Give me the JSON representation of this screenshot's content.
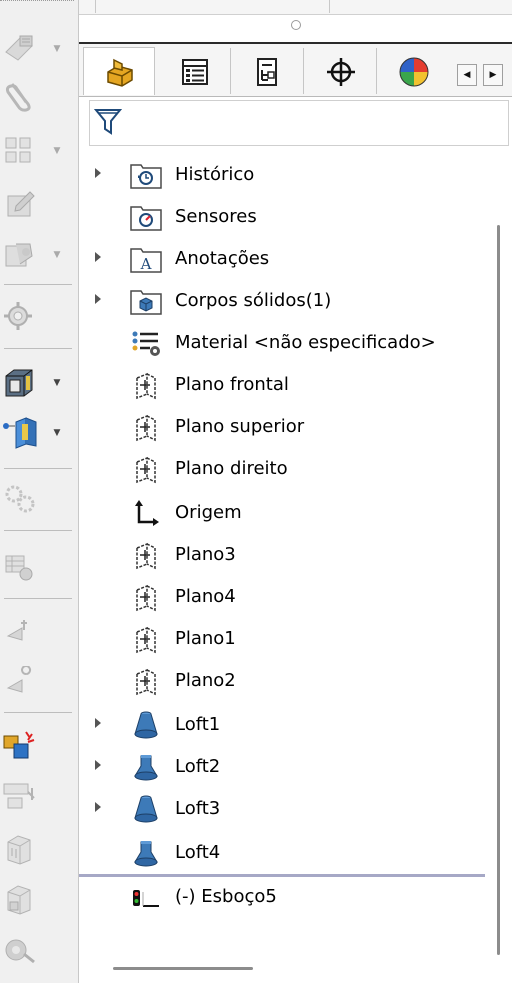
{
  "toolbar": {
    "buttons": [
      {
        "icon": "sketch-icon",
        "has_dropdown": true
      },
      {
        "icon": "paperclip-icon",
        "has_dropdown": false
      },
      {
        "icon": "grid-pattern-icon",
        "has_dropdown": true
      },
      {
        "icon": "document-edit-icon",
        "has_dropdown": false
      },
      {
        "icon": "feature-copy-icon",
        "has_dropdown": true
      },
      {
        "icon": "gear-feature-icon",
        "has_dropdown": false
      },
      {
        "icon": "extrude-boss-icon",
        "has_dropdown": true
      },
      {
        "icon": "reference-plane-icon",
        "has_dropdown": true
      },
      {
        "icon": "gears-icon",
        "has_dropdown": false
      },
      {
        "icon": "display-icon",
        "has_dropdown": false
      },
      {
        "icon": "dimension-icon",
        "has_dropdown": false
      },
      {
        "icon": "dimension-2-icon",
        "has_dropdown": false
      },
      {
        "icon": "instant3d-icon",
        "has_dropdown": false
      },
      {
        "icon": "layout-icon",
        "has_dropdown": false
      },
      {
        "icon": "part-icon",
        "has_dropdown": false
      },
      {
        "icon": "part-2-icon",
        "has_dropdown": false
      },
      {
        "icon": "camera-icon",
        "has_dropdown": false
      }
    ]
  },
  "tabs": [
    {
      "name": "featuremanager-tab",
      "icon": "featuremanager-icon",
      "active": true
    },
    {
      "name": "propertymanager-tab",
      "icon": "propertymanager-icon",
      "active": false
    },
    {
      "name": "configurationmanager-tab",
      "icon": "configurationmanager-icon",
      "active": false
    },
    {
      "name": "dimxpert-tab",
      "icon": "crosshair-icon",
      "active": false
    },
    {
      "name": "displaymanager-tab",
      "icon": "color-wheel-icon",
      "active": false
    }
  ],
  "tree": {
    "items": [
      {
        "label": "Histórico",
        "icon": "history-folder-icon",
        "expandable": true
      },
      {
        "label": "Sensores",
        "icon": "sensor-folder-icon",
        "expandable": false
      },
      {
        "label": "Anotações",
        "icon": "annotation-folder-icon",
        "expandable": true
      },
      {
        "label": "Corpos sólidos(1)",
        "icon": "solid-bodies-folder-icon",
        "expandable": true
      },
      {
        "label": "Material <não especificado>",
        "icon": "material-icon",
        "expandable": false
      },
      {
        "label": "Plano frontal",
        "icon": "plane-icon",
        "expandable": false
      },
      {
        "label": "Plano superior",
        "icon": "plane-icon",
        "expandable": false
      },
      {
        "label": "Plano direito",
        "icon": "plane-icon",
        "expandable": false
      },
      {
        "label": "Origem",
        "icon": "origin-icon",
        "expandable": false
      },
      {
        "label": "Plano3",
        "icon": "plane-icon",
        "expandable": false
      },
      {
        "label": "Plano4",
        "icon": "plane-icon",
        "expandable": false
      },
      {
        "label": "Plano1",
        "icon": "plane-icon",
        "expandable": false
      },
      {
        "label": "Plano2",
        "icon": "plane-icon",
        "expandable": false
      },
      {
        "label": "Loft1",
        "icon": "loft-icon",
        "expandable": true
      },
      {
        "label": "Loft2",
        "icon": "loft-icon",
        "expandable": true
      },
      {
        "label": "Loft3",
        "icon": "loft-icon",
        "expandable": true
      },
      {
        "label": "Loft4",
        "icon": "loft-icon",
        "expandable": false
      },
      {
        "label": "(-) Esboço5",
        "icon": "sketch-icon",
        "expandable": false
      }
    ]
  },
  "colors": {
    "loft": "#3d7ab8",
    "rollback_bar": "#a6a8c6",
    "folder": "#6c7a8c"
  }
}
